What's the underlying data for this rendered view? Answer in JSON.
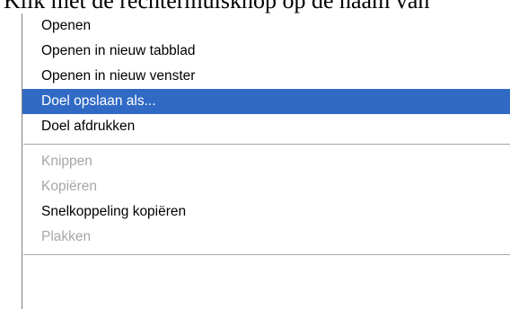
{
  "background_text": "Klik met de rechtermuisknop op de naam van",
  "menu": {
    "groups": [
      {
        "items": [
          {
            "label": "Openen",
            "state": "normal"
          },
          {
            "label": "Openen in nieuw tabblad",
            "state": "normal"
          },
          {
            "label": "Openen in nieuw venster",
            "state": "normal"
          },
          {
            "label": "Doel opslaan als...",
            "state": "highlighted"
          },
          {
            "label": "Doel afdrukken",
            "state": "normal"
          }
        ]
      },
      {
        "items": [
          {
            "label": "Knippen",
            "state": "disabled"
          },
          {
            "label": "Kopiëren",
            "state": "disabled"
          },
          {
            "label": "Snelkoppeling kopiëren",
            "state": "normal"
          },
          {
            "label": "Plakken",
            "state": "disabled"
          }
        ]
      }
    ]
  },
  "colors": {
    "highlight": "#316ac5",
    "disabled_text": "#a7a6aa",
    "separator": "#a7a6aa"
  }
}
